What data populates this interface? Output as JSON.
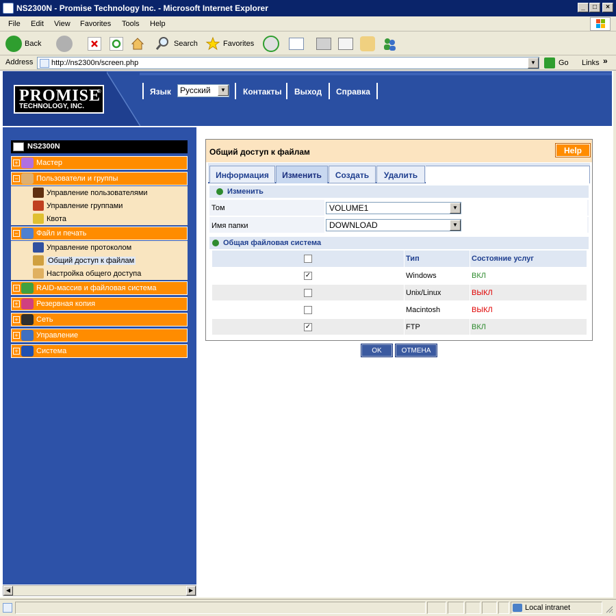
{
  "window": {
    "title": "NS2300N - Promise Technology Inc. - Microsoft Internet Explorer"
  },
  "menu": [
    "File",
    "Edit",
    "View",
    "Favorites",
    "Tools",
    "Help"
  ],
  "toolbar": {
    "back": "Back",
    "search": "Search",
    "favorites": "Favorites"
  },
  "address": {
    "label": "Address",
    "url": "http://ns2300n/screen.php",
    "go": "Go",
    "links": "Links"
  },
  "header": {
    "logo_line1": "PROMISE",
    "logo_line2": "TECHNOLOGY, INC.",
    "lang_label": "Язык",
    "lang_value": "Русский",
    "contacts": "Контакты",
    "logout": "Выход",
    "help": "Справка"
  },
  "tree": {
    "root": "NS2300N",
    "cats": [
      {
        "label": "Мастер",
        "sign": "+"
      },
      {
        "label": "Пользователи и группы",
        "sign": "−"
      },
      {
        "label": "Файл и печать",
        "sign": "−"
      },
      {
        "label": "RAID-массив и файловая система",
        "sign": "+"
      },
      {
        "label": "Резервная копия",
        "sign": "+"
      },
      {
        "label": "Сеть",
        "sign": "+"
      },
      {
        "label": "Управление",
        "sign": "+"
      },
      {
        "label": "Система",
        "sign": "+"
      }
    ],
    "users_sub": [
      "Управление пользователями",
      "Управление группами",
      "Квота"
    ],
    "file_sub": [
      "Управление протоколом",
      "Общий доступ к файлам",
      "Настройка общего доступа"
    ]
  },
  "panel": {
    "title": "Общий доступ к файлам",
    "help": "Help",
    "tabs": [
      "Информация",
      "Изменить",
      "Создать",
      "Удалить"
    ],
    "active_tab": "Изменить",
    "edit_section": "Изменить",
    "volume_label": "Том",
    "volume_value": "VOLUME1",
    "folder_label": "Имя папки",
    "folder_value": "DOWNLOAD",
    "fs_section": "Общая файловая система",
    "col_type": "Тип",
    "col_status": "Состояние услуг",
    "rows": [
      {
        "type": "Windows",
        "status": "ВКЛ",
        "checked": "✓"
      },
      {
        "type": "Unix/Linux",
        "status": "ВЫКЛ",
        "checked": ""
      },
      {
        "type": "Macintosh",
        "status": "ВЫКЛ",
        "checked": ""
      },
      {
        "type": "FTP",
        "status": "ВКЛ",
        "checked": "✓"
      }
    ],
    "ok": "OK",
    "cancel": "ОТМЕНА"
  },
  "status": {
    "zone": "Local intranet"
  },
  "colors": {
    "header_blue": "#2d52a8",
    "orange": "#ff8c00",
    "on_green": "#2e8b2e",
    "off_red": "#e00000"
  }
}
